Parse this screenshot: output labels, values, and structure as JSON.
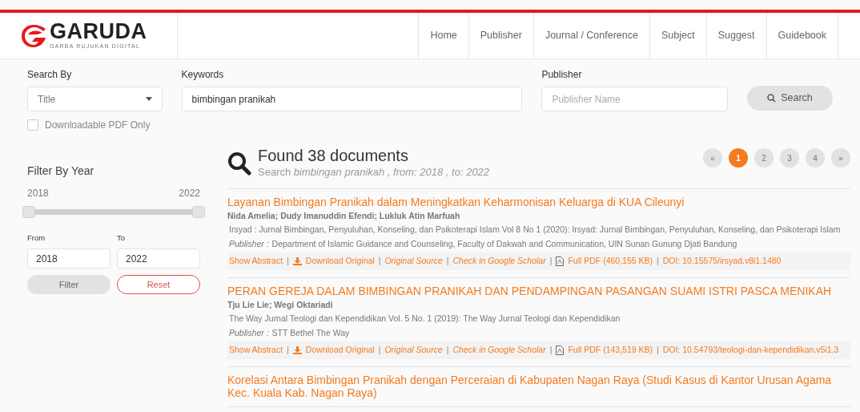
{
  "brand": {
    "name": "GARUDA",
    "tagline": "GARBA RUJUKAN DIGITAL"
  },
  "nav": [
    {
      "label": "Home"
    },
    {
      "label": "Publisher"
    },
    {
      "label": "Journal / Conference"
    },
    {
      "label": "Subject"
    },
    {
      "label": "Suggest"
    },
    {
      "label": "Guidebook"
    }
  ],
  "search": {
    "search_by_label": "Search By",
    "search_by_value": "Title",
    "keywords_label": "Keywords",
    "keywords_value": "bimbingan pranikah",
    "publisher_label": "Publisher",
    "publisher_placeholder": "Publisher Name",
    "button": "Search",
    "pdf_only": {
      "label": "Downloadable PDF Only",
      "checked": false
    }
  },
  "filter": {
    "title": "Filter By Year",
    "min": "2018",
    "max": "2022",
    "from_thumb": {
      "level": 0
    },
    "to_thumb": {
      "level": 1
    },
    "from_label": "From",
    "to_label": "To",
    "from_value": "2018",
    "to_value": "2022",
    "filter_button": "Filter",
    "reset_button": "Reset"
  },
  "results": {
    "heading": "Found 38 documents",
    "summary": "Search *bimbingan pranikah , from: 2018 , to: 2022*",
    "pagination": [
      {
        "label": "«",
        "selected": false
      },
      {
        "label": "1",
        "selected": true
      },
      {
        "label": "2",
        "selected": false
      },
      {
        "label": "3",
        "selected": false
      },
      {
        "label": "4",
        "selected": false
      },
      {
        "label": "»",
        "selected": false
      }
    ],
    "documents": [
      {
        "title": "Layanan Bimbingan Pranikah dalam Meningkatkan Keharmonisan Keluarga di KUA Cileunyi",
        "authors": "Nida Amelia; Dudy Imanuddin Efendi; Lukluk Atin Marfuah",
        "source": "Irsyad : Jurnal Bimbingan, Penyuluhan, Konseling, dan Psikoterapi Islam Vol 8 No 1 (2020): Irsyad: Jurnal Bimbingan, Penyuluhan, Konseling, dan Psikoterapi Islam",
        "publisher_label": "Publisher :",
        "publisher": "Department of Islamic Guidance and Counseling, Faculty of Dakwah and Communication, UIN Sunan Gunung Djati Bandung",
        "links": [
          {
            "kind": "link",
            "text": "Show Abstract"
          },
          {
            "kind": "separator",
            "text": "|"
          },
          {
            "kind": "download",
            "text": "Download Original"
          },
          {
            "kind": "separator",
            "text": "|"
          },
          {
            "kind": "italic",
            "text": "Original Source"
          },
          {
            "kind": "separator",
            "text": "|"
          },
          {
            "kind": "italic",
            "text": "Check in Google Scholar"
          },
          {
            "kind": "separator",
            "text": "|"
          },
          {
            "kind": "pdf",
            "text": "Full PDF (460,155 KB)"
          },
          {
            "kind": "separator",
            "text": "|"
          },
          {
            "kind": "link",
            "text": "DOI: 10.15575/irsyad.v8i1.1480"
          }
        ]
      },
      {
        "title": "PERAN GEREJA DALAM BIMBINGAN PRANIKAH DAN PENDAMPINGAN PASANGAN SUAMI ISTRI PASCA MENIKAH",
        "authors": "Tju Lie Lie; Wegi Oktariadi",
        "source": "The Way Jurnal Teologi dan Kependidikan Vol. 5 No. 1 (2019): The Way Jurnal Teologi dan Kependidikan",
        "publisher_label": "Publisher :",
        "publisher": "STT Bethel The Way",
        "links": [
          {
            "kind": "link",
            "text": "Show Abstract"
          },
          {
            "kind": "separator",
            "text": "|"
          },
          {
            "kind": "download",
            "text": "Download Original"
          },
          {
            "kind": "separator",
            "text": "|"
          },
          {
            "kind": "italic",
            "text": "Original Source"
          },
          {
            "kind": "separator",
            "text": "|"
          },
          {
            "kind": "italic",
            "text": "Check in Google Scholar"
          },
          {
            "kind": "separator",
            "text": "|"
          },
          {
            "kind": "pdf",
            "text": "Full PDF (143,519 KB)"
          },
          {
            "kind": "separator",
            "text": "|"
          },
          {
            "kind": "link",
            "text": "DOI: 10.54793/teologi-dan-kependidikan.v5i1.3"
          }
        ]
      },
      {
        "title": "Korelasi Antara Bimbingan Pranikah dengan Perceraian di Kabupaten Nagan Raya (Studi Kasus di Kantor Urusan Agama Kec. Kuala Kab. Nagan Raya)"
      }
    ]
  }
}
